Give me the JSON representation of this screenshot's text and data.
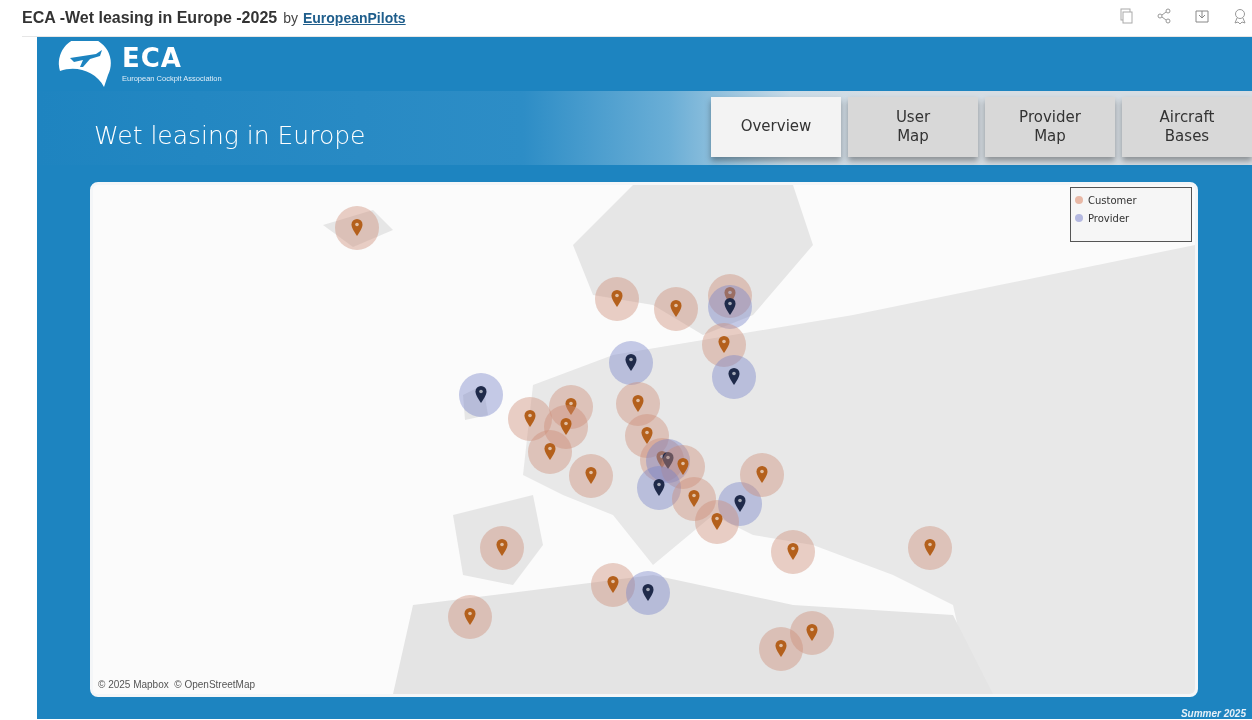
{
  "header": {
    "title": "ECA -Wet leasing in Europe -2025",
    "by": "by",
    "author": "EuropeanPilots"
  },
  "dashboard": {
    "logo": {
      "name": "ECA",
      "subtitle": "European Cockpit Association"
    },
    "title": "Wet leasing in Europe",
    "tabs": [
      {
        "label": "Overview",
        "selected": true
      },
      {
        "label": "User Map",
        "selected": false
      },
      {
        "label": "Provider Map",
        "selected": false
      },
      {
        "label": "Aircraft Bases",
        "selected": false
      }
    ],
    "map": {
      "kind": "picture",
      "legend": [
        {
          "label": "Customer",
          "color": "#e8b8a6"
        },
        {
          "label": "Provider",
          "color": "#b4b8e0"
        }
      ],
      "markers": [
        {
          "kind": "customer"
        },
        {
          "kind": "customer"
        },
        {
          "kind": "customer"
        },
        {
          "kind": "customer"
        },
        {
          "kind": "provider"
        },
        {
          "kind": "provider"
        },
        {
          "kind": "customer"
        },
        {
          "kind": "provider"
        },
        {
          "kind": "provider"
        },
        {
          "kind": "customer"
        },
        {
          "kind": "customer"
        },
        {
          "kind": "customer"
        },
        {
          "kind": "customer"
        },
        {
          "kind": "customer"
        },
        {
          "kind": "customer"
        },
        {
          "kind": "customer"
        },
        {
          "kind": "customer"
        },
        {
          "kind": "provider"
        },
        {
          "kind": "customer"
        },
        {
          "kind": "provider"
        },
        {
          "kind": "customer"
        },
        {
          "kind": "provider"
        },
        {
          "kind": "customer"
        },
        {
          "kind": "customer"
        },
        {
          "kind": "customer"
        },
        {
          "kind": "customer"
        },
        {
          "kind": "customer"
        },
        {
          "kind": "customer"
        },
        {
          "kind": "provider"
        },
        {
          "kind": "customer"
        },
        {
          "kind": "customer"
        },
        {
          "kind": "customer"
        }
      ],
      "attribution": "© 2025 Mapbox  © OpenStreetMap"
    },
    "footer": "Summer 2025"
  }
}
